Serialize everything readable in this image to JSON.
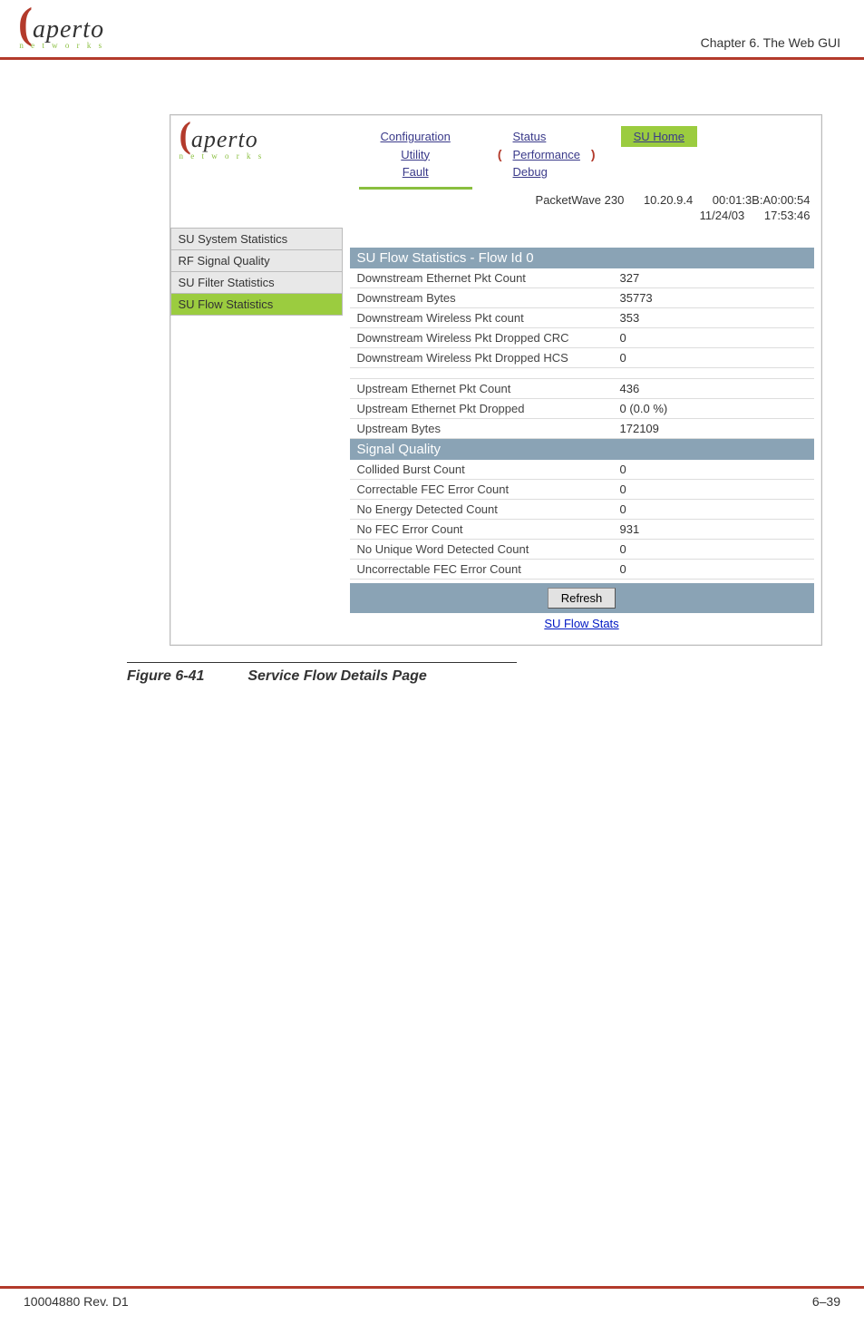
{
  "doc": {
    "chapter_label": "Chapter 6.  The Web GUI",
    "figure_num": "Figure 6-41",
    "figure_title": "Service Flow Details Page",
    "footer_rev": "10004880 Rev. D1",
    "footer_page": "6–39",
    "brand_word": "aperto",
    "brand_sub": "n  e  t  w  o  r  k  s"
  },
  "gui": {
    "logo_word": "aperto",
    "logo_sub": "n  e  t  w  o  r  k  s",
    "menu_col1": {
      "a": "Configuration",
      "b": "Utility",
      "c": "Fault"
    },
    "menu_col2": {
      "a": "Status",
      "b": "Performance",
      "c": "Debug"
    },
    "su_home": "SU Home",
    "meta_line1_a": "PacketWave 230",
    "meta_line1_b": "10.20.9.4",
    "meta_line1_c": "00:01:3B:A0:00:54",
    "meta_line2_a": "11/24/03",
    "meta_line2_b": "17:53:46",
    "side": {
      "0": "SU System Statistics",
      "1": "RF Signal Quality",
      "2": "SU Filter Statistics",
      "3": "SU Flow Statistics"
    },
    "section1_title": "SU Flow Statistics - Flow Id 0",
    "rows1": [
      {
        "label": "Downstream Ethernet Pkt Count",
        "value": "327"
      },
      {
        "label": "Downstream Bytes",
        "value": "35773"
      },
      {
        "label": "Downstream Wireless Pkt count",
        "value": "353"
      },
      {
        "label": "Downstream Wireless Pkt Dropped CRC",
        "value": "0"
      },
      {
        "label": "Downstream Wireless Pkt Dropped HCS",
        "value": "0"
      }
    ],
    "rows1b": [
      {
        "label": "Upstream Ethernet Pkt Count",
        "value": "436"
      },
      {
        "label": "Upstream Ethernet Pkt Dropped",
        "value": "0 (0.0 %)"
      },
      {
        "label": "Upstream Bytes",
        "value": "172109"
      }
    ],
    "section2_title": "Signal Quality",
    "rows2": [
      {
        "label": "Collided Burst Count",
        "value": "0"
      },
      {
        "label": "Correctable FEC Error Count",
        "value": "0"
      },
      {
        "label": "No Energy Detected Count",
        "value": "0"
      },
      {
        "label": "No FEC Error Count",
        "value": "931"
      },
      {
        "label": "No Unique Word Detected Count",
        "value": "0"
      },
      {
        "label": "Uncorrectable FEC Error Count",
        "value": "0"
      }
    ],
    "refresh_label": "Refresh",
    "back_link": "SU Flow Stats"
  }
}
